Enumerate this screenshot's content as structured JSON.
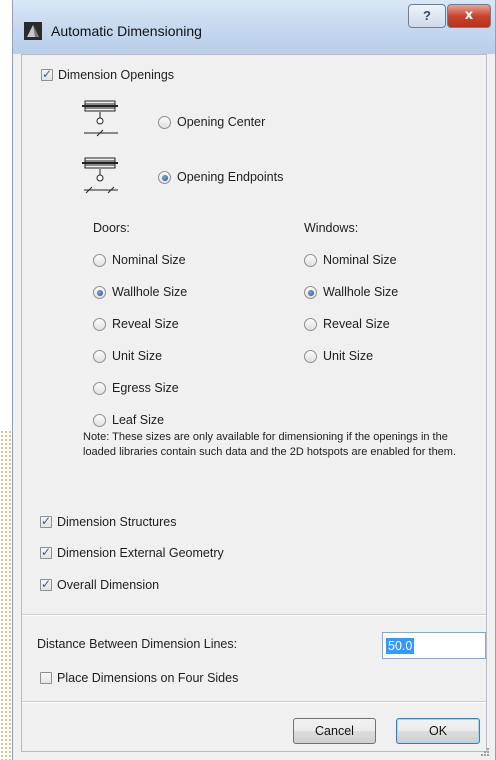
{
  "window": {
    "title": "Automatic Dimensioning",
    "help_glyph": "?",
    "close_glyph": "x"
  },
  "dimension_openings": {
    "label": "Dimension Openings",
    "checked": true,
    "options": [
      {
        "label": "Opening Center",
        "selected": false,
        "icon": "opening-center-icon"
      },
      {
        "label": "Opening Endpoints",
        "selected": true,
        "icon": "opening-endpoints-icon"
      }
    ]
  },
  "doors": {
    "heading": "Doors:",
    "options": [
      {
        "label": "Nominal Size",
        "selected": false
      },
      {
        "label": "Wallhole Size",
        "selected": true
      },
      {
        "label": "Reveal Size",
        "selected": false
      },
      {
        "label": "Unit Size",
        "selected": false
      },
      {
        "label": "Egress Size",
        "selected": false
      },
      {
        "label": "Leaf Size",
        "selected": false
      }
    ]
  },
  "windows": {
    "heading": "Windows:",
    "options": [
      {
        "label": "Nominal Size",
        "selected": false
      },
      {
        "label": "Wallhole Size",
        "selected": true
      },
      {
        "label": "Reveal Size",
        "selected": false
      },
      {
        "label": "Unit Size",
        "selected": false
      }
    ]
  },
  "note": "Note: These sizes are only available for dimensioning if the openings in the loaded libraries contain such data and the 2D hotspots are enabled for them.",
  "checks": [
    {
      "label": "Dimension Structures",
      "checked": true
    },
    {
      "label": "Dimension External Geometry",
      "checked": true
    },
    {
      "label": "Overall Dimension",
      "checked": true
    }
  ],
  "distance": {
    "label": "Distance Between Dimension Lines:",
    "value": "50.0"
  },
  "four_sides": {
    "label": "Place Dimensions on Four Sides",
    "checked": false
  },
  "buttons": {
    "cancel": "Cancel",
    "ok": "OK"
  },
  "check_glyph": "✓"
}
